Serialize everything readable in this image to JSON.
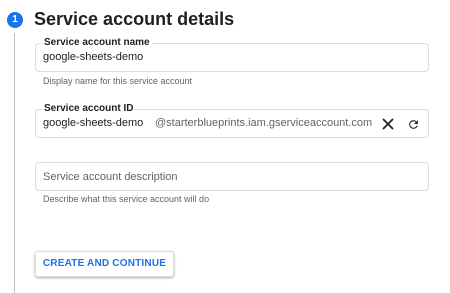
{
  "step": {
    "number": "1",
    "title": "Service account details"
  },
  "name_field": {
    "label": "Service account name",
    "value": "google-sheets-demo",
    "helper": "Display name for this service account"
  },
  "id_field": {
    "label": "Service account ID",
    "value": "google-sheets-demo",
    "suffix": "@starterblueprints.iam.gserviceaccount.com",
    "clear_icon": "close-icon",
    "refresh_icon": "refresh-icon"
  },
  "description_field": {
    "placeholder": "Service account description",
    "value": "",
    "helper": "Describe what this service account will do"
  },
  "actions": {
    "create_label": "CREATE AND CONTINUE"
  },
  "colors": {
    "accent": "#1a73e8",
    "border": "#dadce0",
    "helper_text": "#5f6368",
    "step_line": "#bdc1c6"
  }
}
